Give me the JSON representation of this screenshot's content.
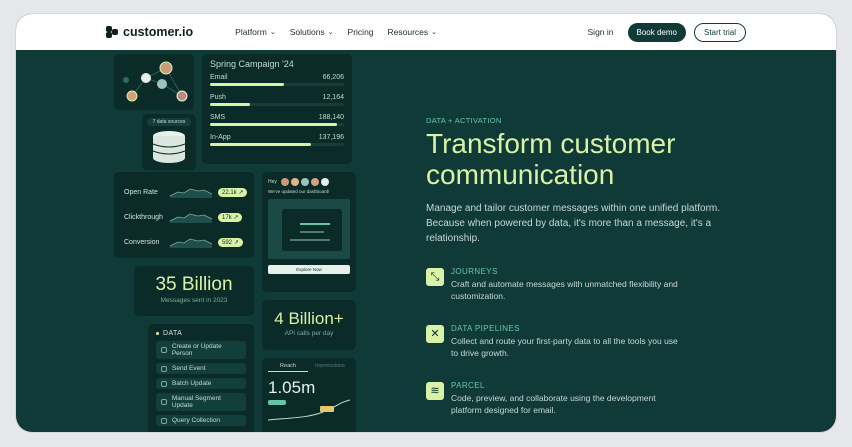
{
  "nav": {
    "logo": "customer.io",
    "links": [
      "Platform",
      "Solutions",
      "Pricing",
      "Resources"
    ],
    "sign_in": "Sign in",
    "book_demo": "Book demo",
    "start_trial": "Start trial"
  },
  "campaign": {
    "title": "Spring Campaign '24",
    "rows": [
      {
        "label": "Email",
        "value": "66,206",
        "fill": 0.55
      },
      {
        "label": "Push",
        "value": "12,164",
        "fill": 0.3
      },
      {
        "label": "SMS",
        "value": "188,140",
        "fill": 0.95
      },
      {
        "label": "In-App",
        "value": "137,196",
        "fill": 0.75
      }
    ]
  },
  "data_sources": {
    "badge": "7 data sources"
  },
  "metrics": [
    {
      "label": "Open Rate",
      "value": "22.1k"
    },
    {
      "label": "Clickthrough",
      "value": "17k"
    },
    {
      "label": "Conversion",
      "value": "592"
    }
  ],
  "notification": {
    "hey": "Hey",
    "message": "We've updated our dashboard!",
    "cta": "Explore Now"
  },
  "stats": {
    "messages_value": "35 Billion",
    "messages_label": "Messages sent in 2023",
    "api_value": "4 Billion+",
    "api_label": "API calls per day"
  },
  "data_panel": {
    "heading": "DATA",
    "items": [
      "Create or Update Person",
      "Send Event",
      "Batch Update",
      "Manual Segment Update",
      "Query Collection"
    ]
  },
  "reach": {
    "tabs": [
      "Reach",
      "Impressions"
    ],
    "value": "1.05m",
    "badge": "200k"
  },
  "hero": {
    "eyebrow": "DATA + ACTIVATION",
    "headline": "Transform customer communication",
    "lede": "Manage and tailor customer messages within one unified platform. Because when powered by data, it's more than a message, it's a relationship.",
    "features": [
      {
        "title": "JOURNEYS",
        "text": "Craft and automate messages with unmatched flexibility and customization.",
        "icon": "journeys-icon"
      },
      {
        "title": "DATA PIPELINES",
        "text": "Collect and route your first-party data to all the tools you use to drive growth.",
        "icon": "pipelines-icon"
      },
      {
        "title": "PARCEL",
        "text": "Code, preview, and collaborate using the development platform designed for email.",
        "icon": "parcel-icon"
      }
    ]
  },
  "colors": {
    "bg": "#0f3a38",
    "accent": "#d9f2a6",
    "teal": "#64c7a8"
  }
}
